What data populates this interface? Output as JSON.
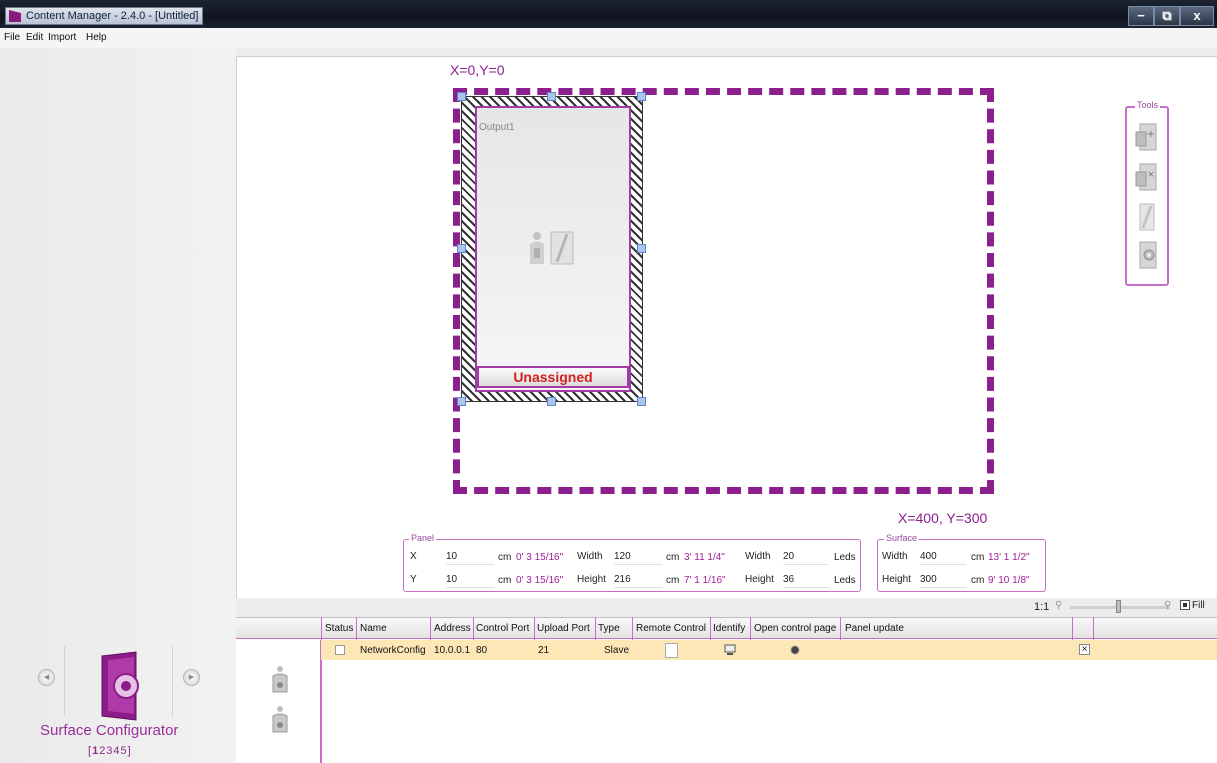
{
  "window": {
    "title": "Content Manager - 2.4.0 - [Untitled]",
    "min_glyph": "−",
    "max_glyph": "⧉",
    "close_glyph": "x"
  },
  "menu": [
    "File",
    "Edit",
    "Import",
    "Help"
  ],
  "surface": {
    "origin_label": "X=0,Y=0",
    "extent_label": "X=400, Y=300",
    "panel_name": "Output1",
    "panel_status": "Unassigned"
  },
  "tools": {
    "label": "Tools",
    "icons": [
      "add-panel-icon",
      "remove-panel-icon",
      "edit-icon",
      "settings-icon"
    ]
  },
  "panel_box": {
    "label": "Panel",
    "x_label": "X",
    "y_label": "Y",
    "x_value": "10",
    "y_value": "10",
    "unit": "cm",
    "x_imperial": "0' 3 15/16\"",
    "y_imperial": "0' 3 15/16\"",
    "width_label": "Width",
    "height_label": "Height",
    "width_value": "120",
    "height_value": "216",
    "width_imperial": "3' 11 1/4\"",
    "height_imperial": "7' 1 1/16\"",
    "leds_width_label": "Width",
    "leds_height_label": "Height",
    "leds_width_value": "20",
    "leds_height_value": "36",
    "leds_unit": "Leds"
  },
  "surface_box": {
    "label": "Surface",
    "width_label": "Width",
    "height_label": "Height",
    "width_value": "400",
    "height_value": "300",
    "unit": "cm",
    "width_imperial": "13' 1 1/2\"",
    "height_imperial": "9' 10 1/8\""
  },
  "zoom": {
    "ratio": "1:1",
    "level": 0.45,
    "fill_label": "Fill"
  },
  "table": {
    "headers": [
      "Status",
      "Name",
      "Address",
      "Control Port",
      "Upload Port",
      "Type",
      "Remote Control",
      "Identify",
      "Open control page",
      "Panel update"
    ],
    "row": {
      "name": "NetworkConfig",
      "address": "10.0.0.1",
      "control_port": "80",
      "upload_port": "21",
      "type": "Slave",
      "remove": "×"
    }
  },
  "nav": {
    "prev": "◀",
    "next": "▶",
    "configurator": "Surface Configurator",
    "pages_open": "[",
    "pages_current": "1",
    "pages_rest": "2345",
    "pages_close": "]"
  },
  "colors": {
    "accent": "#8b1f8e",
    "status_red": "#d42020",
    "row_highlight": "#fde7b6"
  }
}
